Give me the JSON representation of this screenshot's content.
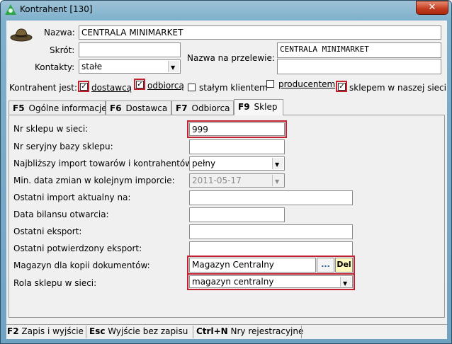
{
  "window": {
    "title": "Kontrahent [130]",
    "close_glyph": "✕"
  },
  "header": {
    "icon": "hat-icon",
    "nazwa_label": "Nazwa:",
    "nazwa_value": "CENTRALA MINIMARKET",
    "skrot_label": "Skrót:",
    "skrot_value": "",
    "kontakty_label": "Kontakty:",
    "kontakty_value": "stałe",
    "przelew_label": "Nazwa na przelewie:",
    "przelew_line1": "CENTRALA MINIMARKET",
    "przelew_line2": ""
  },
  "kontrahent_jest": {
    "label": "Kontrahent jest:",
    "options": [
      {
        "label": "dostawcą",
        "checked": true
      },
      {
        "label": "odbiorcą",
        "checked": true
      },
      {
        "label": "stałym klientem",
        "checked": false
      },
      {
        "label": "producentem",
        "checked": false
      },
      {
        "label": "sklepem w naszej sieci",
        "checked": true
      }
    ]
  },
  "tabs": [
    {
      "key": "F5",
      "label": "Ogólne informacje"
    },
    {
      "key": "F6",
      "label": "Dostawca"
    },
    {
      "key": "F7",
      "label": "Odbiorca"
    },
    {
      "key": "F9",
      "label": "Sklep",
      "active": true
    }
  ],
  "sklep": {
    "nr_sklepu_label": "Nr sklepu w sieci:",
    "nr_sklepu_value": "999",
    "nr_seryjny_label": "Nr seryjny bazy sklepu:",
    "nr_seryjny_value": "",
    "import_label": "Najbliższy import towarów i kontrahentów:",
    "import_value": "pełny",
    "min_data_label": "Min. data zmian w kolejnym imporcie:",
    "min_data_value": "2011-05-17",
    "ostatni_import_label": "Ostatni import aktualny na:",
    "ostatni_import_value": "",
    "bilans_label": "Data bilansu otwarcia:",
    "bilans_value": "",
    "eksport_label": "Ostatni eksport:",
    "eksport_value": "",
    "potwierdzony_label": "Ostatni potwierdzony eksport:",
    "potwierdzony_value": "",
    "magazyn_label": "Magazyn dla kopii dokumentów:",
    "magazyn_value": "Magazyn Centralny",
    "magazyn_browse": "...",
    "magazyn_del": "Del",
    "rola_label": "Rola sklepu w sieci:",
    "rola_value": "magazyn centralny"
  },
  "statusbar": [
    {
      "key": "F2",
      "label": "Zapis i wyjście"
    },
    {
      "key": "Esc",
      "label": "Wyjście bez zapisu"
    },
    {
      "key": "Ctrl+N",
      "label": "Nry rejestracyjne"
    }
  ],
  "colors": {
    "highlight": "#c2202f",
    "title_gradient": "#7fb0cc"
  }
}
